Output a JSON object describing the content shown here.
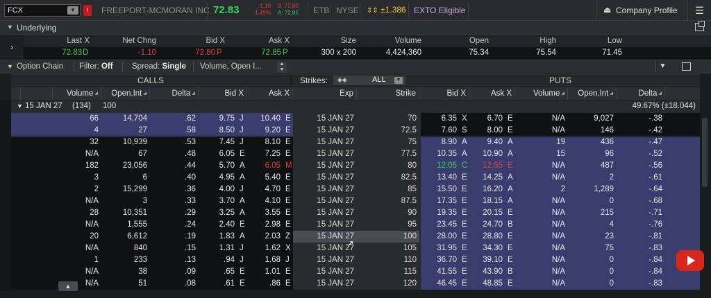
{
  "header": {
    "symbol": "FCX",
    "flag": "!",
    "company": "FREEPORT-MCMORAN INC",
    "last_price": "72.83",
    "net_change": "-1.10",
    "pct_change": "-1.49%",
    "bid_mini": "B: 72.80",
    "ask_mini": "A: 72.85",
    "etb": "ETB",
    "exchange": "NYSE",
    "expected_move": "±1.386",
    "exto": "EXTO Eligible",
    "company_profile": "Company Profile",
    "colors": {
      "price_up": "#2fd15a",
      "price_down": "#e53c3c",
      "itm_row": "#3a3c6e",
      "exto": "#c9a0e6"
    }
  },
  "underlying": {
    "title": "Underlying",
    "headers": [
      "Last X",
      "Net Chng",
      "Bid X",
      "Ask X",
      "Size",
      "Volume",
      "Open",
      "High",
      "Low"
    ],
    "last": "72.83",
    "last_ex": "D",
    "net_chng": "-1.10",
    "bid": "72.80",
    "bid_ex": "P",
    "ask": "72.85",
    "ask_ex": "P",
    "size": "300 x 200",
    "volume": "4,424,360",
    "open": "75.34",
    "high": "75.54",
    "low": "71.45"
  },
  "option_chain": {
    "title": "Option Chain",
    "filter_label": "Filter:",
    "filter_value": "Off",
    "spread_label": "Spread:",
    "spread_value": "Single",
    "layout": "Volume, Open I...",
    "calls_label": "CALLS",
    "puts_label": "PUTS",
    "strikes_label": "Strikes:",
    "strikes_value": "ALL",
    "call_headers": [
      "Volume",
      "Open.Int",
      "Delta",
      "Bid X",
      "Ask X"
    ],
    "mid_headers": [
      "Exp",
      "Strike"
    ],
    "put_headers": [
      "Bid X",
      "Ask X",
      "Volume",
      "Open.Int",
      "Delta"
    ],
    "group": {
      "expiry": "15 JAN 27",
      "days": "(134)",
      "multiplier": "100",
      "iv": "49.67% (±18.044)"
    },
    "rows": [
      {
        "c_vol": "66",
        "c_oi": "14,704",
        "c_delta": ".62",
        "c_bid": "9.75",
        "c_bx": "J",
        "c_ask": "10.40",
        "c_ax": "E",
        "exp": "15 JAN 27",
        "strike": "70",
        "p_bid": "6.35",
        "p_bx": "X",
        "p_ask": "6.70",
        "p_ax": "E",
        "p_vol": "N/A",
        "p_oi": "9,027",
        "p_delta": "-.38"
      },
      {
        "c_vol": "4",
        "c_oi": "27",
        "c_delta": ".58",
        "c_bid": "8.50",
        "c_bx": "J",
        "c_ask": "9.20",
        "c_ax": "E",
        "exp": "15 JAN 27",
        "strike": "72.5",
        "p_bid": "7.60",
        "p_bx": "S",
        "p_ask": "8.00",
        "p_ax": "E",
        "p_vol": "N/A",
        "p_oi": "146",
        "p_delta": "-.42"
      },
      {
        "c_vol": "32",
        "c_oi": "10,939",
        "c_delta": ".53",
        "c_bid": "7.45",
        "c_bx": "J",
        "c_ask": "8.10",
        "c_ax": "E",
        "exp": "15 JAN 27",
        "strike": "75",
        "p_bid": "8.90",
        "p_bx": "A",
        "p_ask": "9.40",
        "p_ax": "A",
        "p_vol": "19",
        "p_oi": "436",
        "p_delta": "-.47"
      },
      {
        "c_vol": "N/A",
        "c_oi": "67",
        "c_delta": ".48",
        "c_bid": "6.05",
        "c_bx": "E",
        "c_ask": "7.25",
        "c_ax": "E",
        "exp": "15 JAN 27",
        "strike": "77.5",
        "p_bid": "10.35",
        "p_bx": "A",
        "p_ask": "10.90",
        "p_ax": "A",
        "p_vol": "15",
        "p_oi": "96",
        "p_delta": "-.52"
      },
      {
        "c_vol": "182",
        "c_oi": "23,056",
        "c_delta": ".44",
        "c_bid": "5.70",
        "c_bx": "A",
        "c_ask": "6.05",
        "c_ax": "M",
        "exp": "15 JAN 27",
        "strike": "80",
        "p_bid": "12.05",
        "p_bx": "C",
        "p_ask": "12.55",
        "p_ax": "E",
        "p_vol": "N/A",
        "p_oi": "487",
        "p_delta": "-.56"
      },
      {
        "c_vol": "3",
        "c_oi": "6",
        "c_delta": ".40",
        "c_bid": "4.95",
        "c_bx": "A",
        "c_ask": "5.40",
        "c_ax": "E",
        "exp": "15 JAN 27",
        "strike": "82.5",
        "p_bid": "13.40",
        "p_bx": "E",
        "p_ask": "14.25",
        "p_ax": "A",
        "p_vol": "N/A",
        "p_oi": "2",
        "p_delta": "-.61"
      },
      {
        "c_vol": "2",
        "c_oi": "15,299",
        "c_delta": ".36",
        "c_bid": "4.00",
        "c_bx": "J",
        "c_ask": "4.70",
        "c_ax": "E",
        "exp": "15 JAN 27",
        "strike": "85",
        "p_bid": "15.50",
        "p_bx": "E",
        "p_ask": "16.20",
        "p_ax": "A",
        "p_vol": "2",
        "p_oi": "1,289",
        "p_delta": "-.64"
      },
      {
        "c_vol": "N/A",
        "c_oi": "3",
        "c_delta": ".33",
        "c_bid": "3.70",
        "c_bx": "A",
        "c_ask": "4.10",
        "c_ax": "E",
        "exp": "15 JAN 27",
        "strike": "87.5",
        "p_bid": "17.35",
        "p_bx": "E",
        "p_ask": "18.15",
        "p_ax": "A",
        "p_vol": "N/A",
        "p_oi": "0",
        "p_delta": "-.68"
      },
      {
        "c_vol": "28",
        "c_oi": "10,351",
        "c_delta": ".29",
        "c_bid": "3.25",
        "c_bx": "A",
        "c_ask": "3.55",
        "c_ax": "E",
        "exp": "15 JAN 27",
        "strike": "90",
        "p_bid": "19.35",
        "p_bx": "E",
        "p_ask": "20.15",
        "p_ax": "E",
        "p_vol": "N/A",
        "p_oi": "215",
        "p_delta": "-.71"
      },
      {
        "c_vol": "N/A",
        "c_oi": "1,555",
        "c_delta": ".24",
        "c_bid": "2.40",
        "c_bx": "E",
        "c_ask": "2.98",
        "c_ax": "E",
        "exp": "15 JAN 27",
        "strike": "95",
        "p_bid": "23.45",
        "p_bx": "E",
        "p_ask": "24.70",
        "p_ax": "B",
        "p_vol": "N/A",
        "p_oi": "4",
        "p_delta": "-.76"
      },
      {
        "c_vol": "20",
        "c_oi": "6,612",
        "c_delta": ".19",
        "c_bid": "1.83",
        "c_bx": "A",
        "c_ask": "2.03",
        "c_ax": "Z",
        "exp": "15 JAN 27",
        "strike": "100",
        "p_bid": "28.00",
        "p_bx": "E",
        "p_ask": "28.80",
        "p_ax": "E",
        "p_vol": "N/A",
        "p_oi": "23",
        "p_delta": "-.81"
      },
      {
        "c_vol": "N/A",
        "c_oi": "840",
        "c_delta": ".15",
        "c_bid": "1.31",
        "c_bx": "J",
        "c_ask": "1.62",
        "c_ax": "X",
        "exp": "15 JAN 27",
        "strike": "105",
        "p_bid": "31.95",
        "p_bx": "E",
        "p_ask": "34.30",
        "p_ax": "E",
        "p_vol": "N/A",
        "p_oi": "75",
        "p_delta": "-.83"
      },
      {
        "c_vol": "1",
        "c_oi": "233",
        "c_delta": ".13",
        "c_bid": ".94",
        "c_bx": "J",
        "c_ask": "1.68",
        "c_ax": "J",
        "exp": "15 JAN 27",
        "strike": "110",
        "p_bid": "36.70",
        "p_bx": "E",
        "p_ask": "39.10",
        "p_ax": "E",
        "p_vol": "N/A",
        "p_oi": "0",
        "p_delta": "-.84"
      },
      {
        "c_vol": "N/A",
        "c_oi": "38",
        "c_delta": ".09",
        "c_bid": ".65",
        "c_bx": "E",
        "c_ask": "1.01",
        "c_ax": "E",
        "exp": "15 JAN 27",
        "strike": "115",
        "p_bid": "41.55",
        "p_bx": "E",
        "p_ask": "43.90",
        "p_ax": "B",
        "p_vol": "N/A",
        "p_oi": "0",
        "p_delta": "-.84"
      },
      {
        "c_vol": "N/A",
        "c_oi": "51",
        "c_delta": ".08",
        "c_bid": ".61",
        "c_bx": "E",
        "c_ask": ".86",
        "c_ax": "E",
        "exp": "15 JAN 27",
        "strike": "120",
        "p_bid": "46.45",
        "p_bx": "E",
        "p_ask": "48.85",
        "p_ax": "E",
        "p_vol": "N/A",
        "p_oi": "0",
        "p_delta": "-.83"
      }
    ]
  }
}
